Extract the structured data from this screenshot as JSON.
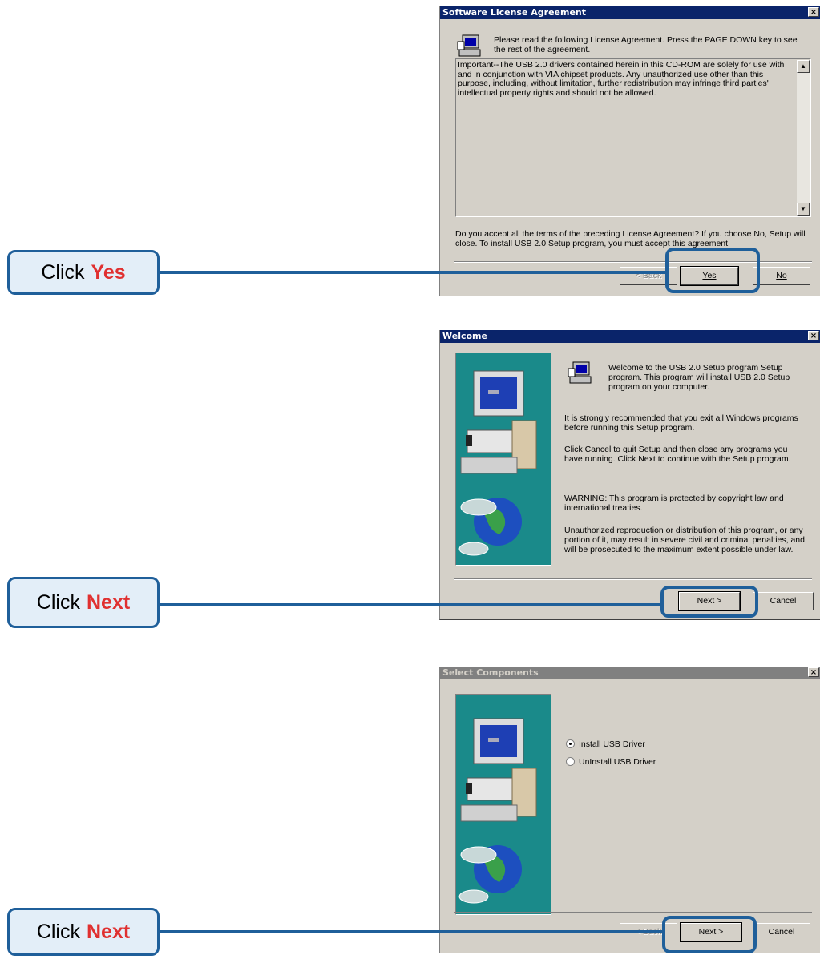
{
  "dialogs": {
    "license": {
      "title": "Software License Agreement",
      "close_label": "×",
      "intro": "Please read the following License Agreement.  Press the PAGE DOWN key to see the rest of the agreement.",
      "license_text": "Important--The USB 2.0 drivers contained herein in this CD-ROM are solely for use with and in conjunction with VIA chipset products. Any unauthorized use other than this purpose, including, without limitation, further redistribution may infringe third parties' intellectual property rights and should not be allowed.",
      "question": "Do you accept all the terms of the preceding License Agreement?  If you choose No,  Setup will close.  To install USB 2.0 Setup program, you must accept this agreement.",
      "buttons": {
        "back": "< Back",
        "yes": "Yes",
        "no": "No"
      },
      "scroll_up": "▲",
      "scroll_down": "▼"
    },
    "welcome": {
      "title": "Welcome",
      "close_label": "×",
      "para1": "Welcome to the USB 2.0 Setup program Setup program.  This program will install USB 2.0 Setup program on your computer.",
      "para2": "It is strongly recommended that you exit all Windows programs before running this Setup program.",
      "para3": "Click Cancel to quit Setup and then close any programs you have running.  Click Next to continue with the Setup program.",
      "para4": "WARNING: This program is protected by copyright law and international treaties.",
      "para5": "Unauthorized reproduction or distribution of this program, or any portion of it, may result in severe civil and criminal penalties, and will be prosecuted to the maximum extent possible under law.",
      "buttons": {
        "next": "Next >",
        "cancel": "Cancel"
      }
    },
    "components": {
      "title": "Select Components",
      "close_label": "×",
      "options": [
        {
          "label": "Install USB Driver",
          "selected": true
        },
        {
          "label": "UnInstall USB Driver",
          "selected": false
        }
      ],
      "buttons": {
        "back": "< Back",
        "next": "Next >",
        "cancel": "Cancel"
      }
    }
  },
  "callouts": [
    {
      "prefix": "Click",
      "action": "Yes"
    },
    {
      "prefix": "Click",
      "action": "Next"
    },
    {
      "prefix": "Click",
      "action": "Next"
    }
  ],
  "colors": {
    "callout_border": "#1f5f9a",
    "callout_fill": "#e3eef8",
    "action_text": "#e03030",
    "titlebar_active": "#0a246a"
  }
}
